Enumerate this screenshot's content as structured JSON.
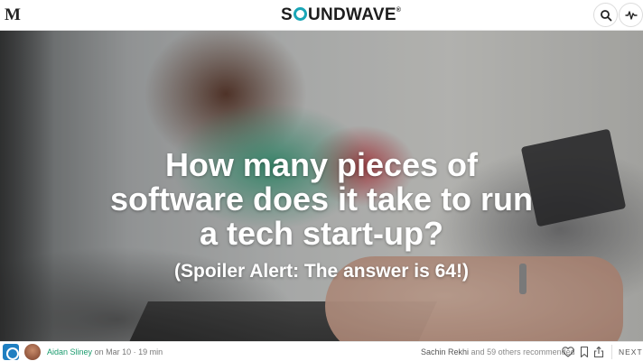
{
  "header": {
    "site_mark": "M",
    "brand_prefix": "S",
    "brand_suffix": "UNDWAVE",
    "brand_trademark": "®",
    "search_icon": "search-icon",
    "activity_icon": "activity-icon"
  },
  "hero": {
    "headline": "How many pieces of software does it take to run a tech start-up?",
    "subheadline": "(Spoiler Alert: The answer is 64!)"
  },
  "footer": {
    "author_name": "Aidan Sliney",
    "date_prefix": "on Mar 10",
    "separator": "·",
    "read_time": "19 min",
    "recommender": "Sachin Rekhi",
    "recommend_suffix": "and 59 others",
    "recommend_label": "recommended",
    "next_label": "NEXT S"
  },
  "colors": {
    "brand_accent": "#1aa6b7",
    "author_link": "#1b9b6e",
    "publication_icon": "#1f7fc1"
  }
}
